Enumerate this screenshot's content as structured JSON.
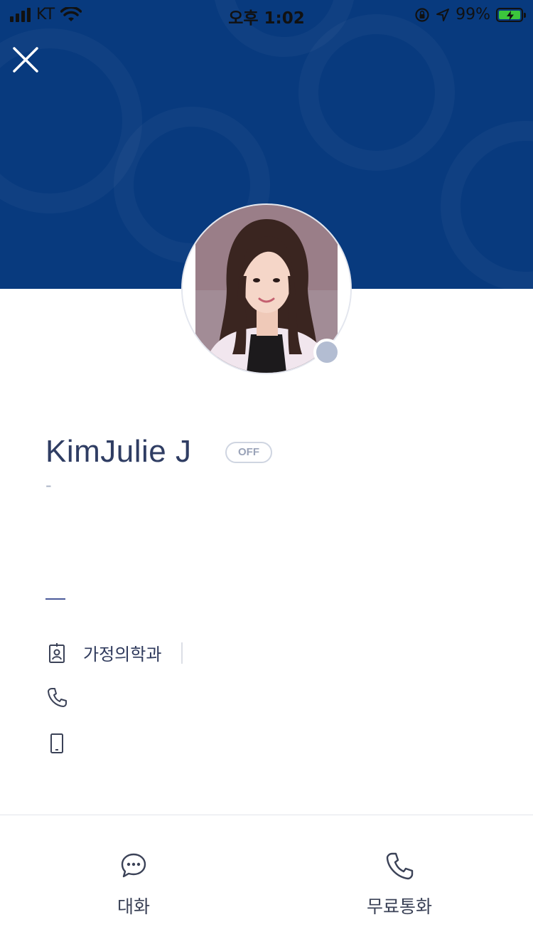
{
  "status_bar": {
    "carrier": "KT",
    "time": "오후 1:02",
    "battery_percent": "99%",
    "icons": [
      "signal-icon",
      "wifi-icon",
      "orientation-lock-icon",
      "location-arrow-icon",
      "battery-charging-icon"
    ]
  },
  "header": {
    "background_color": "#083a7e",
    "close_icon": "close-icon"
  },
  "profile": {
    "name": "KimJulie J",
    "presence_badge": "OFF",
    "presence_dot_color": "#b3bdd2",
    "status_message": "-"
  },
  "info": {
    "department": "가정의학과",
    "rows": [
      {
        "icon": "id-badge-icon",
        "value": "가정의학과"
      },
      {
        "icon": "phone-icon",
        "value": ""
      },
      {
        "icon": "mobile-phone-icon",
        "value": ""
      }
    ]
  },
  "actions": {
    "chat_label": "대화",
    "call_label": "무료통화",
    "chat_icon": "chat-bubble-icon",
    "call_icon": "phone-icon"
  }
}
